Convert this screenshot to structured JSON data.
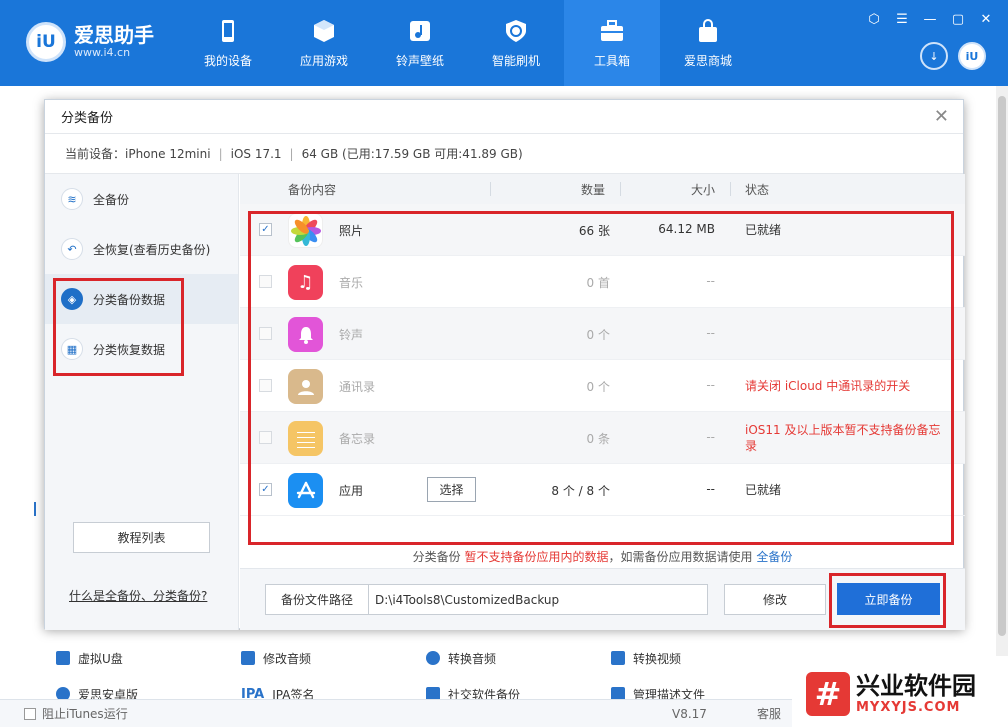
{
  "app": {
    "name": "爱思助手",
    "url": "www.i4.cn",
    "logo_mark": "iU",
    "accent": "#1a76d9"
  },
  "nav": [
    {
      "label": "我的设备",
      "icon": "phone-icon"
    },
    {
      "label": "应用游戏",
      "icon": "cube-icon"
    },
    {
      "label": "铃声壁纸",
      "icon": "music-folder-icon"
    },
    {
      "label": "智能刷机",
      "icon": "refresh-shield-icon"
    },
    {
      "label": "工具箱",
      "icon": "toolbox-icon",
      "active": true
    },
    {
      "label": "爱思商城",
      "icon": "shopping-bag-icon"
    }
  ],
  "window_controls": [
    "skin-icon",
    "menu-icon",
    "minimize-icon",
    "maximize-icon",
    "close-icon"
  ],
  "top_circle_buttons": {
    "download": "download-icon",
    "avatar": "iU"
  },
  "dialog": {
    "title": "分类备份",
    "device_info": {
      "device": "当前设备：iPhone 12mini",
      "ios": "iOS 17.1",
      "storage": "64 GB (已用:17.59 GB 可用:41.89 GB)"
    },
    "left_menu": [
      {
        "label": "全备份",
        "icon": "layers-icon"
      },
      {
        "label": "全恢复(查看历史备份)",
        "icon": "back-arrow-icon"
      },
      {
        "label": "分类备份数据",
        "icon": "box-icon",
        "active": true
      },
      {
        "label": "分类恢复数据",
        "icon": "grid-icon"
      }
    ],
    "tutorial_button": "教程列表",
    "help_link": "什么是全备份、分类备份?",
    "table": {
      "headers": {
        "content": "备份内容",
        "qty": "数量",
        "size": "大小",
        "status": "状态"
      },
      "rows": [
        {
          "name": "照片",
          "qty": "66 张",
          "size": "64.12 MB",
          "status": "已就绪",
          "checked": true,
          "disabled": false,
          "icon": "photos-icon",
          "icon_color": "#ffffff"
        },
        {
          "name": "音乐",
          "qty": "0 首",
          "size": "--",
          "status": "",
          "checked": false,
          "disabled": true,
          "icon": "music-icon",
          "icon_color": "#f0415b"
        },
        {
          "name": "铃声",
          "qty": "0 个",
          "size": "--",
          "status": "",
          "checked": false,
          "disabled": true,
          "icon": "bell-icon",
          "icon_color": "#e255d8"
        },
        {
          "name": "通讯录",
          "qty": "0 个",
          "size": "--",
          "status": "请关闭 iCloud 中通讯录的开关",
          "checked": false,
          "disabled": true,
          "icon": "contacts-icon",
          "icon_color": "#d9b98c",
          "status_red": true
        },
        {
          "name": "备忘录",
          "qty": "0 条",
          "size": "--",
          "status": "iOS11 及以上版本暂不支持备份备忘录",
          "checked": false,
          "disabled": true,
          "icon": "notes-icon",
          "icon_color": "#f5c565",
          "status_red": true
        },
        {
          "name": "应用",
          "qty": "8 个 / 8 个",
          "size": "--",
          "status": "已就绪",
          "checked": true,
          "disabled": false,
          "icon": "appstore-icon",
          "icon_color": "#1b8ff2",
          "select_button": "选择"
        }
      ]
    },
    "notice": {
      "prefix": "分类备份 ",
      "red": "暂不支持备份应用内的数据",
      "middle": "，如需备份应用数据请使用 ",
      "link": "全备份"
    },
    "footer": {
      "path_label": "备份文件路径",
      "path_value": "D:\\i4Tools8\\CustomizedBackup",
      "modify_button": "修改",
      "backup_button": "立即备份"
    }
  },
  "background_tools": [
    {
      "label": "虚拟U盘",
      "icon": "usb-icon"
    },
    {
      "label": "修改音频",
      "icon": "audio-edit-icon"
    },
    {
      "label": "转换音频",
      "icon": "convert-audio-icon"
    },
    {
      "label": "转换视频",
      "icon": "convert-video-icon"
    },
    {
      "label": "爱思安卓版",
      "icon": "android-icon"
    },
    {
      "label": "IPA签名",
      "icon": "ipa-icon",
      "icon_text": "IPA"
    },
    {
      "label": "社交软件备份",
      "icon": "social-backup-icon"
    },
    {
      "label": "管理描述文件",
      "icon": "profile-icon"
    }
  ],
  "statusbar": {
    "itunes": "阻止iTunes运行",
    "version": "V8.17",
    "service": "客服"
  },
  "watermark": {
    "title": "兴业软件园",
    "url": "MYXYJS.COM",
    "mark": "#"
  }
}
